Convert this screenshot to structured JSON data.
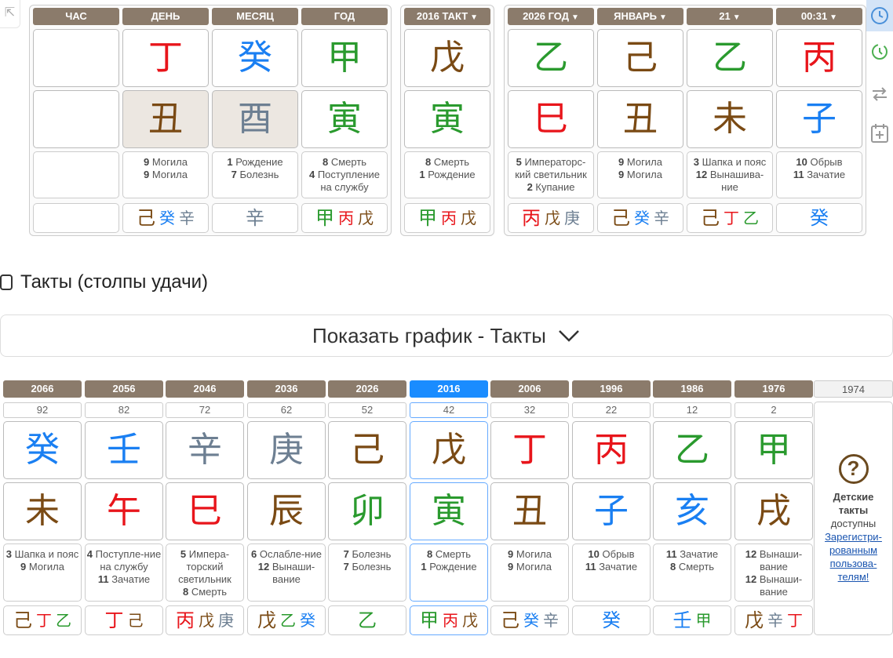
{
  "natal": {
    "headers": [
      "ЧАС",
      "ДЕНЬ",
      "МЕСЯЦ",
      "ГОД"
    ],
    "stems": [
      {
        "char": "",
        "color": ""
      },
      {
        "char": "丁",
        "color": "red"
      },
      {
        "char": "癸",
        "color": "blue"
      },
      {
        "char": "甲",
        "color": "green"
      }
    ],
    "branches": [
      {
        "char": "",
        "color": ""
      },
      {
        "char": "丑",
        "color": "brown"
      },
      {
        "char": "酉",
        "color": "gray"
      },
      {
        "char": "寅",
        "color": "green"
      }
    ],
    "notes": [
      [],
      [
        {
          "n": "9",
          "t": "Могила"
        },
        {
          "n": "9",
          "t": "Могила"
        }
      ],
      [
        {
          "n": "1",
          "t": "Рождение"
        },
        {
          "n": "7",
          "t": "Болезнь"
        }
      ],
      [
        {
          "n": "8",
          "t": "Смерть"
        },
        {
          "n": "4",
          "t": "Поступление на службу"
        }
      ]
    ],
    "hidden": [
      [],
      [
        {
          "c": "己",
          "color": "brown"
        },
        {
          "c": "癸",
          "color": "blue"
        },
        {
          "c": "辛",
          "color": "gray"
        }
      ],
      [
        {
          "c": "辛",
          "color": "gray"
        }
      ],
      [
        {
          "c": "甲",
          "color": "green"
        },
        {
          "c": "丙",
          "color": "red"
        },
        {
          "c": "戊",
          "color": "brown"
        }
      ]
    ]
  },
  "takt": {
    "header": "2016 ТАКТ",
    "stem": {
      "char": "戊",
      "color": "brown"
    },
    "branch": {
      "char": "寅",
      "color": "green"
    },
    "notes": [
      {
        "n": "8",
        "t": "Смерть"
      },
      {
        "n": "1",
        "t": "Рождение"
      }
    ],
    "hidden": [
      {
        "c": "甲",
        "color": "green"
      },
      {
        "c": "丙",
        "color": "red"
      },
      {
        "c": "戊",
        "color": "brown"
      }
    ]
  },
  "current": {
    "headers": [
      "2026 ГОД",
      "ЯНВАРЬ",
      "21",
      "00:31"
    ],
    "stems": [
      {
        "char": "乙",
        "color": "green"
      },
      {
        "char": "己",
        "color": "brown"
      },
      {
        "char": "乙",
        "color": "green"
      },
      {
        "char": "丙",
        "color": "red"
      }
    ],
    "branches": [
      {
        "char": "巳",
        "color": "red"
      },
      {
        "char": "丑",
        "color": "brown"
      },
      {
        "char": "未",
        "color": "brown"
      },
      {
        "char": "子",
        "color": "blue"
      }
    ],
    "notes": [
      [
        {
          "n": "5",
          "t": "Императорс-кий светильник"
        },
        {
          "n": "2",
          "t": "Купание"
        }
      ],
      [
        {
          "n": "9",
          "t": "Могила"
        },
        {
          "n": "9",
          "t": "Могила"
        }
      ],
      [
        {
          "n": "3",
          "t": "Шапка и пояс"
        },
        {
          "n": "12",
          "t": "Вынашива-ние"
        }
      ],
      [
        {
          "n": "10",
          "t": "Обрыв"
        },
        {
          "n": "11",
          "t": "Зачатие"
        }
      ]
    ],
    "hidden": [
      [
        {
          "c": "丙",
          "color": "red"
        },
        {
          "c": "戊",
          "color": "brown"
        },
        {
          "c": "庚",
          "color": "gray"
        }
      ],
      [
        {
          "c": "己",
          "color": "brown"
        },
        {
          "c": "癸",
          "color": "blue"
        },
        {
          "c": "辛",
          "color": "gray"
        }
      ],
      [
        {
          "c": "己",
          "color": "brown"
        },
        {
          "c": "丁",
          "color": "red"
        },
        {
          "c": "乙",
          "color": "green"
        }
      ],
      [
        {
          "c": "癸",
          "color": "blue"
        }
      ]
    ]
  },
  "takts_toggle_label": "Такты (столпы удачи)",
  "show_chart_label": "Показать график - Такты",
  "pillars": [
    {
      "year": "2066",
      "age": "92",
      "stem": {
        "char": "癸",
        "color": "blue"
      },
      "branch": {
        "char": "未",
        "color": "brown"
      },
      "notes": [
        {
          "n": "3",
          "t": "Шапка и пояс"
        },
        {
          "n": "9",
          "t": "Могила"
        }
      ],
      "hidden": [
        {
          "c": "己",
          "color": "brown"
        },
        {
          "c": "丁",
          "color": "red"
        },
        {
          "c": "乙",
          "color": "green"
        }
      ]
    },
    {
      "year": "2056",
      "age": "82",
      "stem": {
        "char": "壬",
        "color": "blue"
      },
      "branch": {
        "char": "午",
        "color": "red"
      },
      "notes": [
        {
          "n": "4",
          "t": "Поступле-ние на службу"
        },
        {
          "n": "11",
          "t": "Зачатие"
        }
      ],
      "hidden": [
        {
          "c": "丁",
          "color": "red"
        },
        {
          "c": "己",
          "color": "brown"
        }
      ]
    },
    {
      "year": "2046",
      "age": "72",
      "stem": {
        "char": "辛",
        "color": "gray"
      },
      "branch": {
        "char": "巳",
        "color": "red"
      },
      "notes": [
        {
          "n": "5",
          "t": "Импера-торский светильник"
        },
        {
          "n": "8",
          "t": "Смерть"
        }
      ],
      "hidden": [
        {
          "c": "丙",
          "color": "red"
        },
        {
          "c": "戊",
          "color": "brown"
        },
        {
          "c": "庚",
          "color": "gray"
        }
      ]
    },
    {
      "year": "2036",
      "age": "62",
      "stem": {
        "char": "庚",
        "color": "gray"
      },
      "branch": {
        "char": "辰",
        "color": "brown"
      },
      "notes": [
        {
          "n": "6",
          "t": "Ослабле-ние"
        },
        {
          "n": "12",
          "t": "Вынаши-вание"
        }
      ],
      "hidden": [
        {
          "c": "戊",
          "color": "brown"
        },
        {
          "c": "乙",
          "color": "green"
        },
        {
          "c": "癸",
          "color": "blue"
        }
      ]
    },
    {
      "year": "2026",
      "age": "52",
      "stem": {
        "char": "己",
        "color": "brown"
      },
      "branch": {
        "char": "卯",
        "color": "green"
      },
      "notes": [
        {
          "n": "7",
          "t": "Болезнь"
        },
        {
          "n": "7",
          "t": "Болезнь"
        }
      ],
      "hidden": [
        {
          "c": "乙",
          "color": "green"
        }
      ]
    },
    {
      "year": "2016",
      "age": "42",
      "active": true,
      "stem": {
        "char": "戊",
        "color": "brown"
      },
      "branch": {
        "char": "寅",
        "color": "green"
      },
      "notes": [
        {
          "n": "8",
          "t": "Смерть"
        },
        {
          "n": "1",
          "t": "Рождение"
        }
      ],
      "hidden": [
        {
          "c": "甲",
          "color": "green"
        },
        {
          "c": "丙",
          "color": "red"
        },
        {
          "c": "戊",
          "color": "brown"
        }
      ]
    },
    {
      "year": "2006",
      "age": "32",
      "stem": {
        "char": "丁",
        "color": "red"
      },
      "branch": {
        "char": "丑",
        "color": "brown"
      },
      "notes": [
        {
          "n": "9",
          "t": "Могила"
        },
        {
          "n": "9",
          "t": "Могила"
        }
      ],
      "hidden": [
        {
          "c": "己",
          "color": "brown"
        },
        {
          "c": "癸",
          "color": "blue"
        },
        {
          "c": "辛",
          "color": "gray"
        }
      ]
    },
    {
      "year": "1996",
      "age": "22",
      "stem": {
        "char": "丙",
        "color": "red"
      },
      "branch": {
        "char": "子",
        "color": "blue"
      },
      "notes": [
        {
          "n": "10",
          "t": "Обрыв"
        },
        {
          "n": "11",
          "t": "Зачатие"
        }
      ],
      "hidden": [
        {
          "c": "癸",
          "color": "blue"
        }
      ]
    },
    {
      "year": "1986",
      "age": "12",
      "stem": {
        "char": "乙",
        "color": "green"
      },
      "branch": {
        "char": "亥",
        "color": "blue"
      },
      "notes": [
        {
          "n": "11",
          "t": "Зачатие"
        },
        {
          "n": "8",
          "t": "Смерть"
        }
      ],
      "hidden": [
        {
          "c": "壬",
          "color": "blue"
        },
        {
          "c": "甲",
          "color": "green"
        }
      ]
    },
    {
      "year": "1976",
      "age": "2",
      "stem": {
        "char": "甲",
        "color": "green"
      },
      "branch": {
        "char": "戌",
        "color": "brown"
      },
      "notes": [
        {
          "n": "12",
          "t": "Вынаши-вание"
        },
        {
          "n": "12",
          "t": "Вынаши-вание"
        }
      ],
      "hidden": [
        {
          "c": "戊",
          "color": "brown"
        },
        {
          "c": "辛",
          "color": "gray"
        },
        {
          "c": "丁",
          "color": "red"
        }
      ]
    }
  ],
  "kids": {
    "year": "1974",
    "title": "Детские такты",
    "desc": "доступны",
    "link": "Зарегистри-рованным пользова-телям!"
  },
  "colors": {
    "red": "#e8151b",
    "blue": "#1a7ff2",
    "green": "#2a9a2e",
    "brown": "#7a4a14",
    "gray": "#6d7f92",
    "header": "#8b7b6b",
    "active": "#1a8cff"
  },
  "icons": [
    "clock-icon",
    "history-icon",
    "swap-icon",
    "calendar-add-icon",
    "collapse-icon",
    "chevron-down-icon"
  ]
}
